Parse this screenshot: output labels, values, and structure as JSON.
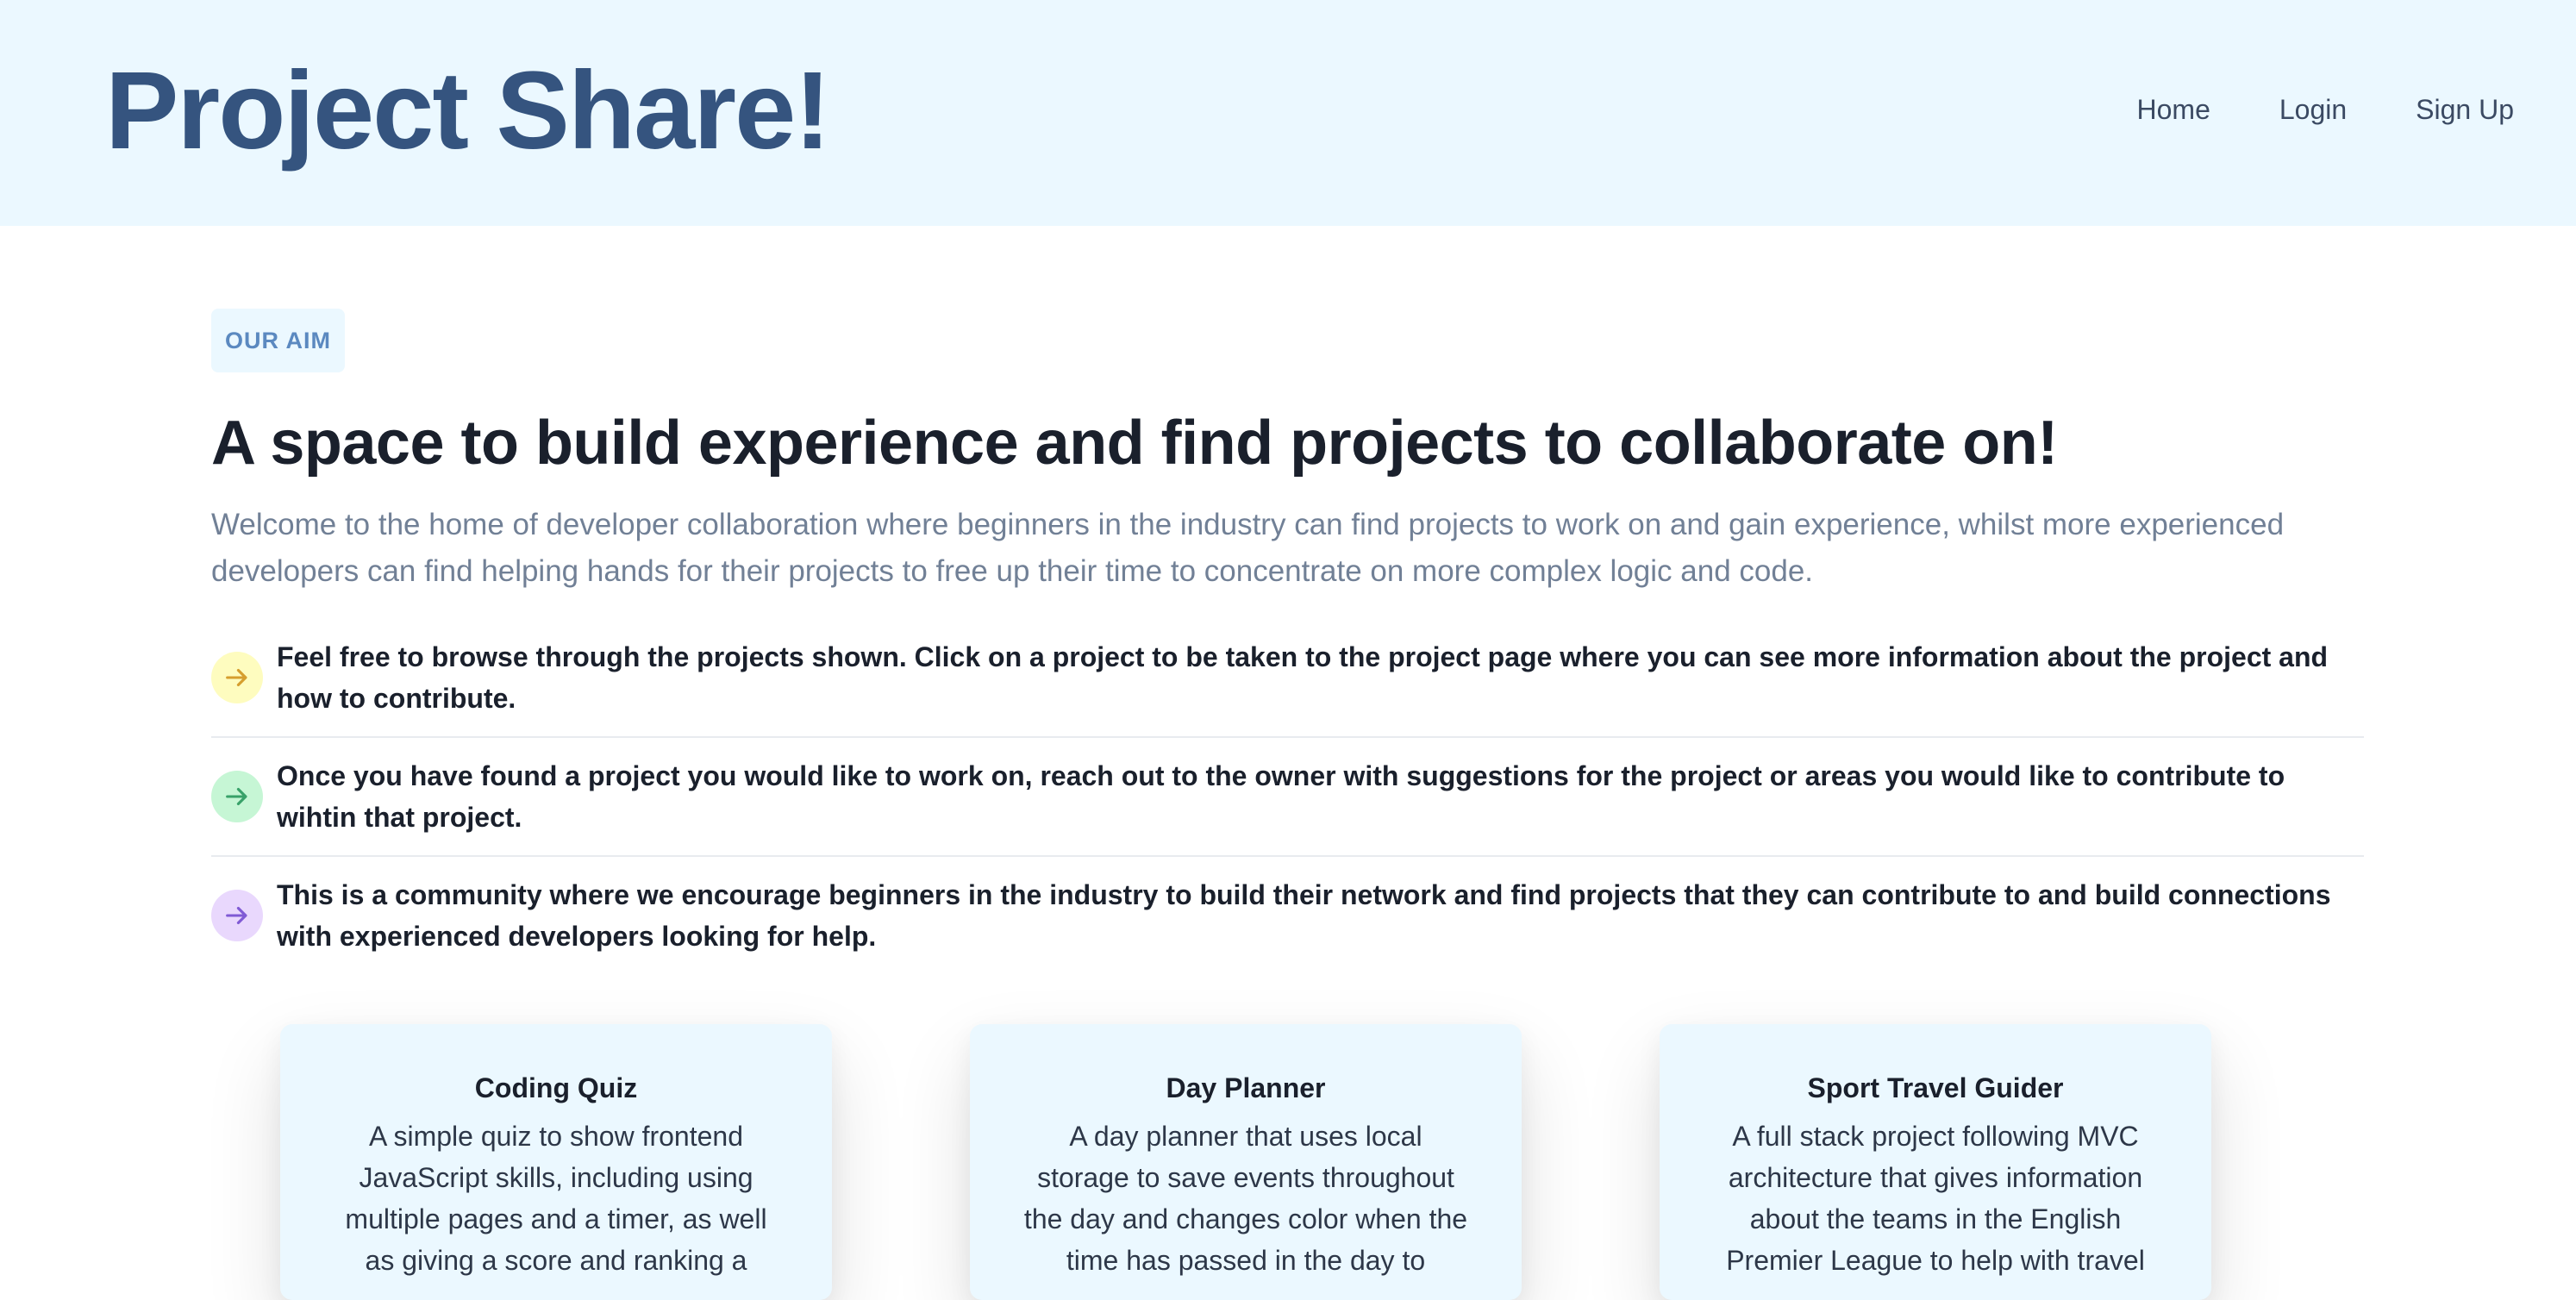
{
  "header": {
    "brand": "Project Share!",
    "nav": [
      "Home",
      "Login",
      "Sign Up"
    ]
  },
  "hero": {
    "badge": "OUR AIM",
    "headline": "A space to build experience and find projects to collaborate on!",
    "intro": "Welcome to the home of developer collaboration where beginners in the industry can find projects to work on and gain experience, whilst more experienced developers can find helping hands for their projects to free up their time to concentrate on more complex logic and code."
  },
  "features": [
    {
      "icon": "arrow-right-icon",
      "color": "#d69e2e",
      "text": "Feel free to browse through the projects shown. Click on a project to be taken to the project page where you can see more information about the project and how to contribute."
    },
    {
      "icon": "arrow-right-icon",
      "color": "#38a169",
      "text": "Once you have found a project you would like to work on, reach out to the owner with suggestions for the project or areas you would like to contribute to wihtin that project."
    },
    {
      "icon": "arrow-right-icon",
      "color": "#805ad5",
      "text": "This is a community where we encourage beginners in the industry to build their network and find projects that they can contribute to and build connections with experienced developers looking for help."
    }
  ],
  "projects": [
    {
      "title": "Coding Quiz",
      "description": "A simple quiz to show frontend JavaScript skills, including using multiple pages and a timer, as well as giving a score and ranking a"
    },
    {
      "title": "Day Planner",
      "description": "A day planner that uses local storage to save events throughout the day and changes color when the time has passed in the day to"
    },
    {
      "title": "Sport Travel Guider",
      "description": "A full stack project following MVC architecture that gives information about the teams in the English Premier League to help with travel"
    }
  ],
  "colors": {
    "header_bg": "#ebf8ff",
    "brand": "#35547f",
    "badge_text": "#5b89c0",
    "muted_text": "#718096"
  }
}
